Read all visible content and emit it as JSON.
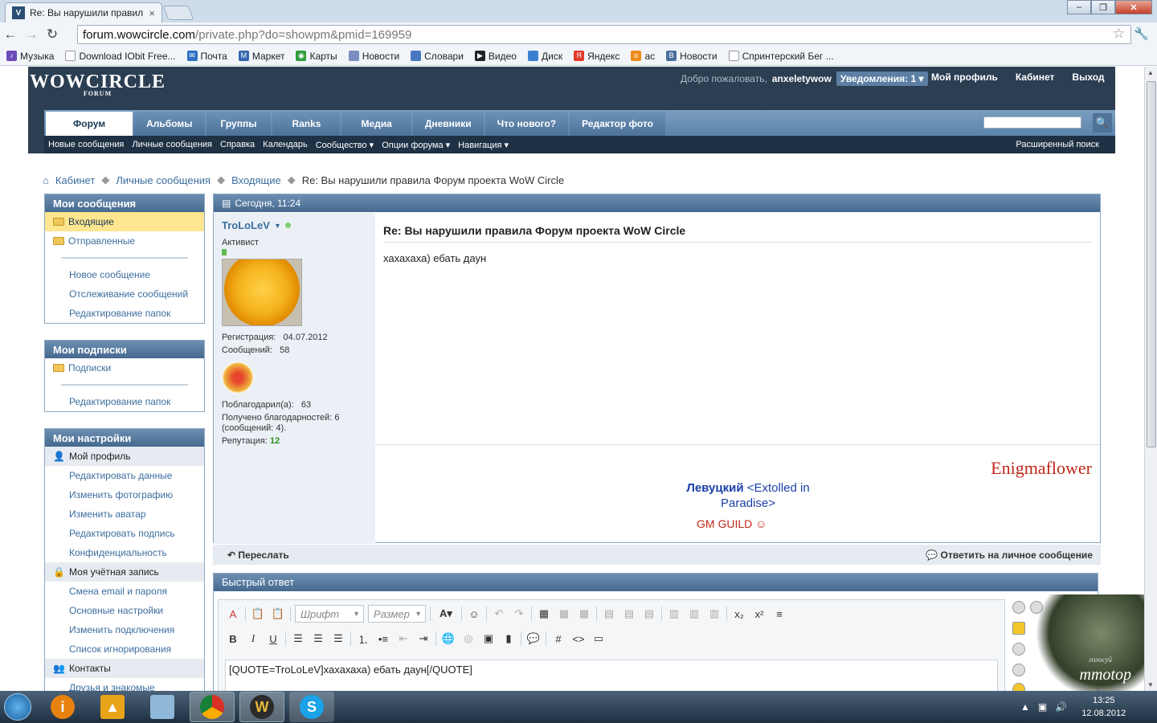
{
  "browser": {
    "tab_title": "Re: Вы нарушили правил",
    "url_host": "forum.wowcircle.com",
    "url_path": "/private.php?do=showpm&pmid=169959",
    "bookmarks": [
      "Музыка",
      "Download IObit Free...",
      "Почта",
      "Маркет",
      "Карты",
      "Новости",
      "Словари",
      "Видео",
      "Диск",
      "Яндекс",
      "ас",
      "Новости",
      "Спринтерский Бег ..."
    ]
  },
  "header": {
    "logo": "WOWCIRCLE",
    "logo_sub": "FORUM",
    "welcome": "Добро пожаловать,",
    "username": "anxeletywow",
    "notifications": "Уведомления: 1",
    "links": [
      "Мой профиль",
      "Кабинет",
      "Выход"
    ]
  },
  "nav": {
    "tabs": [
      "Форум",
      "Альбомы",
      "Группы",
      "Ranks",
      "Медиа",
      "Дневники",
      "Что нового?",
      "Редактор фото"
    ],
    "sub": [
      "Новые сообщения",
      "Личные сообщения",
      "Справка",
      "Календарь",
      "Сообщество ▾",
      "Опции форума ▾",
      "Навигация ▾"
    ],
    "advanced_search": "Расширенный поиск"
  },
  "breadcrumb": [
    "Кабинет",
    "Личные сообщения",
    "Входящие"
  ],
  "breadcrumb_current": "Re: Вы нарушили правила Форум проекта WoW Circle",
  "sidebar": {
    "messages_title": "Мои сообщения",
    "inbox": "Входящие",
    "sent": "Отправленные",
    "messages_links": [
      "Новое сообщение",
      "Отслеживание сообщений",
      "Редактирование папок"
    ],
    "subs_title": "Мои подписки",
    "subs": "Подписки",
    "subs_edit": "Редактирование папок",
    "settings_title": "Мои настройки",
    "profile_head": "Мой профиль",
    "profile_links": [
      "Редактировать данные",
      "Изменить фотографию",
      "Изменить аватар",
      "Редактировать подпись",
      "Конфиденциальность"
    ],
    "account_head": "Моя учётная запись",
    "account_links": [
      "Смена email и пароля",
      "Основные настройки",
      "Изменить подключения",
      "Список игнорирования"
    ],
    "contacts_head": "Контакты",
    "contacts_link": "Друзья и знакомые"
  },
  "pm": {
    "date": "Сегодня, 11:24",
    "author": "TroLoLeV",
    "rank": "Активист",
    "reg_label": "Регистрация:",
    "reg_value": "04.07.2012",
    "posts_label": "Сообщений:",
    "posts_value": "58",
    "thanked_label": "Поблагодарил(а):",
    "thanked_value": "63",
    "received": "Получено благодарностей: 6 (сообщений: 4).",
    "rep_label": "Репутация:",
    "rep_value": "12",
    "title": "Re: Вы нарушили правила Форум проекта WoW Circle",
    "body": "хахахаха) ебать даун",
    "sig_right": "Enigmaflower",
    "sig_name": "Левуцкий",
    "sig_guild": "<Extolled in Paradise>",
    "sig_gm": "GM GUILD",
    "forward": "Переслать",
    "reply": "Ответить на личное сообщение"
  },
  "quick_reply": {
    "title": "Быстрый ответ",
    "font_placeholder": "Шрифт",
    "size_placeholder": "Размер",
    "text": "[QUOTE=TroLoLeV]хахахаха) ебать даун[/QUOTE]"
  },
  "ad": {
    "text": "mmotop",
    "sub": "голосуй"
  },
  "taskbar": {
    "time": "13:25",
    "date": "12.08.2012"
  }
}
